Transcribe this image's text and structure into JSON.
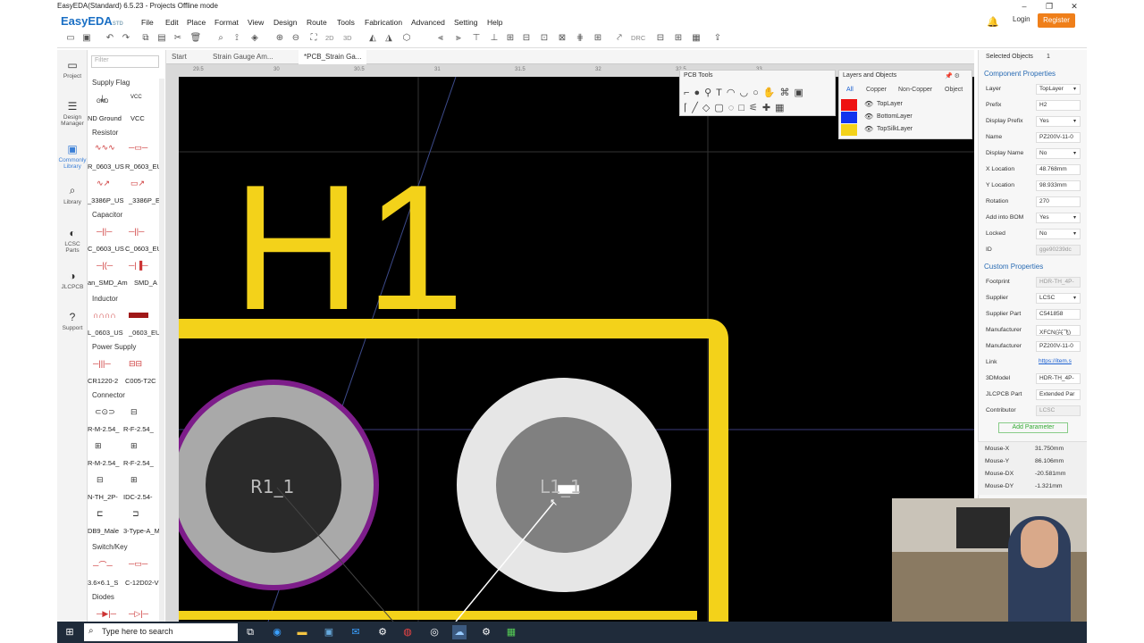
{
  "window": {
    "title": "EasyEDA(Standard) 6.5.23 - Projects Offline mode",
    "controls": [
      "–",
      "❐",
      "✕"
    ]
  },
  "app": {
    "logo": "EasyEDA",
    "logo_suffix": "STD",
    "menu": [
      "File",
      "Edit",
      "Place",
      "Format",
      "View",
      "Design",
      "Route",
      "Tools",
      "Fabrication",
      "Advanced",
      "Setting",
      "Help"
    ],
    "login": "Login",
    "register": "Register",
    "bell_icon": "bell-icon",
    "accent": "#ef7f1a"
  },
  "toolbar": {
    "labels": {
      "2d": "2D",
      "3d": "3D",
      "drc": "DRC"
    }
  },
  "leftnav": [
    {
      "label": "Project",
      "icon": "folder-icon"
    },
    {
      "label": "Design Manager",
      "icon": "list-icon"
    },
    {
      "label": "Commonly Library",
      "icon": "component-icon"
    },
    {
      "label": "Library",
      "icon": "search-icon"
    },
    {
      "label": "LCSC Parts",
      "icon": "lcsc-icon"
    },
    {
      "label": "JLCPCB",
      "icon": "jlcpcb-icon"
    },
    {
      "label": "Support",
      "icon": "help-icon"
    }
  ],
  "library": {
    "filter_placeholder": "Filter",
    "categories": [
      {
        "name": "Supply Flag",
        "parts": [
          "ND Ground",
          "VCC"
        ],
        "sub": [
          "GND",
          "VCC"
        ]
      },
      {
        "name": "Resistor",
        "parts": [
          "R_0603_US",
          "R_0603_EU",
          "_3386P_US",
          "_3386P_E"
        ]
      },
      {
        "name": "Capacitor",
        "parts": [
          "C_0603_US",
          "C_0603_EU",
          "an_SMD_Am",
          "SMD_A"
        ]
      },
      {
        "name": "Inductor",
        "parts": [
          "L_0603_US",
          "_0603_EU"
        ]
      },
      {
        "name": "Power Supply",
        "parts": [
          "CR1220-2",
          "C005-T2C"
        ]
      },
      {
        "name": "Connector",
        "parts": [
          "R-M-2.54_",
          "R-F-2.54_",
          "R-M-2.54_",
          "R-F-2.54_",
          "N-TH_2P-",
          "IDC-2.54-",
          "DB9_Male",
          "3-Type-A_M"
        ]
      },
      {
        "name": "Switch/Key",
        "parts": [
          "3.6×6.1_S",
          "C-12D02-V"
        ]
      },
      {
        "name": "Diodes",
        "parts": []
      }
    ]
  },
  "tabs": [
    {
      "label": "Start",
      "active": false
    },
    {
      "label": "Strain Gauge Am...",
      "active": false
    },
    {
      "label": "*PCB_Strain Ga...",
      "active": true
    }
  ],
  "ruler": {
    "ticks": [
      "29.5",
      "30",
      "30.5",
      "31",
      "31.5",
      "32",
      "32.5",
      "33"
    ]
  },
  "pcb": {
    "silk_text": "H1",
    "pad_left": "R1_1",
    "pad_right": "L1_1",
    "silk_color": "#f3d21a",
    "pad_outline_color": "#7d1d8a"
  },
  "pcb_tools": {
    "title": "PCB Tools"
  },
  "layers_panel": {
    "title": "Layers and Objects",
    "tabs": [
      "All",
      "Copper",
      "Non-Copper",
      "Object"
    ],
    "layers": [
      {
        "name": "TopLayer",
        "color": "#ee1111"
      },
      {
        "name": "BottomLayer",
        "color": "#1133ee"
      },
      {
        "name": "TopSilkLayer",
        "color": "#f3d21a"
      }
    ]
  },
  "properties": {
    "selected_label": "Selected Objects",
    "selected_count": "1",
    "component_header": "Component Properties",
    "component": [
      {
        "label": "Layer",
        "value": "TopLayer",
        "select": true
      },
      {
        "label": "Prefix",
        "value": "H2",
        "select": false
      },
      {
        "label": "Display Prefix",
        "value": "Yes",
        "select": true
      },
      {
        "label": "Name",
        "value": "PZ200V-11-0",
        "select": false
      },
      {
        "label": "Display Name",
        "value": "No",
        "select": true
      },
      {
        "label": "X Location",
        "value": "48.768mm",
        "select": false
      },
      {
        "label": "Y Location",
        "value": "98.933mm",
        "select": false
      },
      {
        "label": "Rotation",
        "value": "270",
        "select": false
      },
      {
        "label": "Add into BOM",
        "value": "Yes",
        "select": true
      },
      {
        "label": "Locked",
        "value": "No",
        "select": true
      },
      {
        "label": "ID",
        "value": "gge90239dc",
        "select": false,
        "disabled": true
      }
    ],
    "custom_header": "Custom Properties",
    "custom": [
      {
        "label": "Footprint",
        "value": "HDR-TH_4P-",
        "disabled": true
      },
      {
        "label": "Supplier",
        "value": "LCSC",
        "select": true
      },
      {
        "label": "Supplier Part",
        "value": "C541858"
      },
      {
        "label": "Manufacturer",
        "value": "XFCN(兴飞)"
      },
      {
        "label": "Manufacturer",
        "value": "PZ200V-11-0"
      },
      {
        "label": "Link",
        "value": "https://item.s",
        "link": true
      },
      {
        "label": "3DModel",
        "value": "HDR-TH_4P-"
      },
      {
        "label": "JLCPCB Part",
        "value": "Extended Par"
      },
      {
        "label": "Contributor",
        "value": "LCSC",
        "disabled": true
      }
    ],
    "add_param": "Add Parameter"
  },
  "mouse": [
    {
      "label": "Mouse-X",
      "value": "31.750mm"
    },
    {
      "label": "Mouse-Y",
      "value": "86.106mm"
    },
    {
      "label": "Mouse-DX",
      "value": "-20.581mm"
    },
    {
      "label": "Mouse-DY",
      "value": "-1.321mm"
    }
  ],
  "taskbar": {
    "search_placeholder": "Type here to search",
    "icons": [
      "windows-icon",
      "task-view-icon",
      "edge-icon",
      "file-explorer-icon",
      "store-icon",
      "mail-icon",
      "settings-icon",
      "chrome-icon",
      "obs-icon",
      "easyeda-icon",
      "app-icon",
      "excel-icon"
    ]
  }
}
